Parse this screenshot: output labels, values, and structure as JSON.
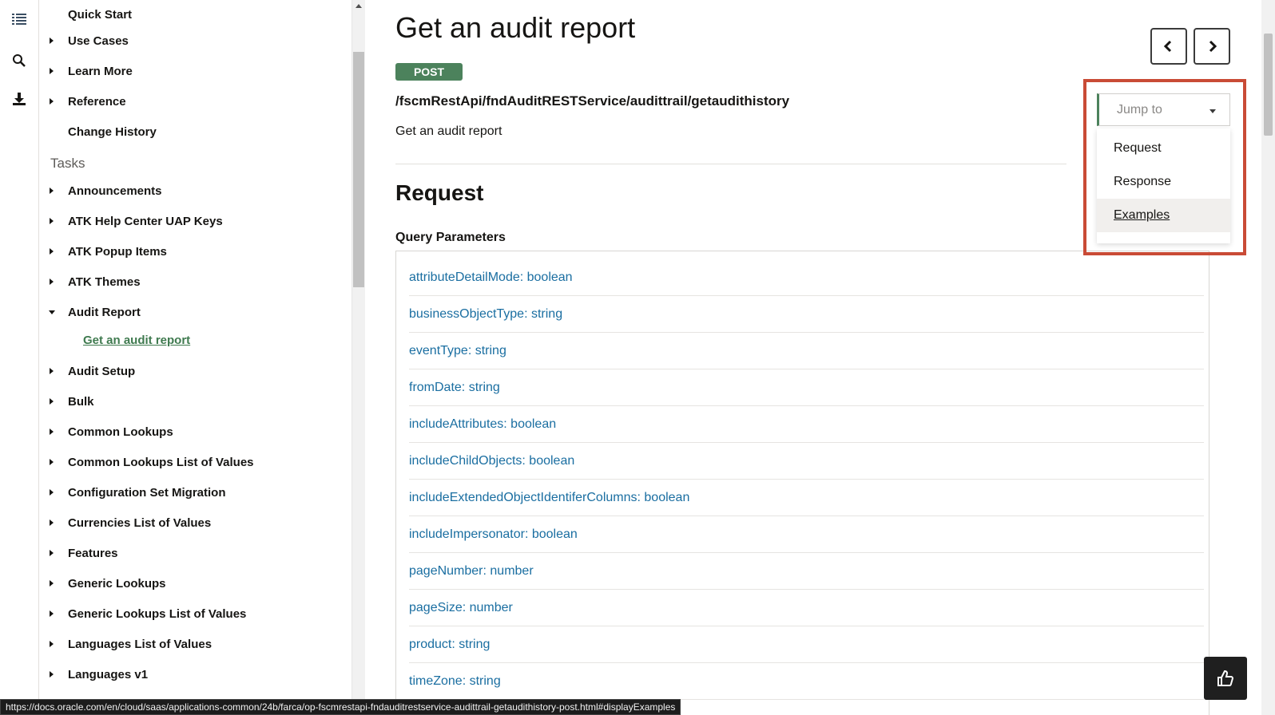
{
  "rail": {
    "icons": [
      "list-icon",
      "search-icon",
      "download-icon"
    ]
  },
  "nav": {
    "top_items": [
      {
        "label": "Quick Start",
        "expandable": false
      },
      {
        "label": "Use Cases",
        "expandable": true
      },
      {
        "label": "Learn More",
        "expandable": true
      },
      {
        "label": "Reference",
        "expandable": true
      },
      {
        "label": "Change History",
        "expandable": false
      }
    ],
    "tasks_heading": "Tasks",
    "task_items": [
      {
        "label": "Announcements",
        "expanded": false
      },
      {
        "label": "ATK Help Center UAP Keys",
        "expanded": false
      },
      {
        "label": "ATK Popup Items",
        "expanded": false
      },
      {
        "label": "ATK Themes",
        "expanded": false
      },
      {
        "label": "Audit Report",
        "expanded": true
      },
      {
        "label": "Audit Setup",
        "expanded": false
      },
      {
        "label": "Bulk",
        "expanded": false
      },
      {
        "label": "Common Lookups",
        "expanded": false
      },
      {
        "label": "Common Lookups List of Values",
        "expanded": false
      },
      {
        "label": "Configuration Set Migration",
        "expanded": false
      },
      {
        "label": "Currencies List of Values",
        "expanded": false
      },
      {
        "label": "Features",
        "expanded": false
      },
      {
        "label": "Generic Lookups",
        "expanded": false
      },
      {
        "label": "Generic Lookups List of Values",
        "expanded": false
      },
      {
        "label": "Languages List of Values",
        "expanded": false
      },
      {
        "label": "Languages v1",
        "expanded": false
      }
    ],
    "audit_report_child": "Get an audit report"
  },
  "main": {
    "title": "Get an audit report",
    "method": "POST",
    "endpoint": "/fscmRestApi/fndAuditRESTService/audittrail/getaudithistory",
    "description": "Get an audit report",
    "request_heading": "Request",
    "query_heading": "Query Parameters",
    "params": [
      "attributeDetailMode: boolean",
      "businessObjectType: string",
      "eventType: string",
      "fromDate: string",
      "includeAttributes: boolean",
      "includeChildObjects: boolean",
      "includeExtendedObjectIdentiferColumns: boolean",
      "includeImpersonator: boolean",
      "pageNumber: number",
      "pageSize: number",
      "product: string",
      "timeZone: string"
    ]
  },
  "jump": {
    "placeholder": "Jump to",
    "options": [
      "Request",
      "Response",
      "Examples"
    ],
    "hovered": "Examples"
  },
  "status_url": "https://docs.oracle.com/en/cloud/saas/applications-common/24b/farca/op-fscmrestapi-fndauditrestservice-audittrail-getaudithistory-post.html#displayExamples",
  "colors": {
    "post_badge": "#4c825c",
    "link": "#1a6ea1",
    "highlight_box": "#c94b36",
    "active_link": "#3f7a4f"
  }
}
